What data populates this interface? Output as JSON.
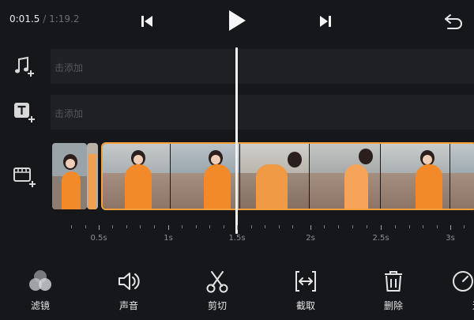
{
  "playback": {
    "current_time": "0:01.5",
    "separator": "/",
    "total_time": "1:19.2"
  },
  "tracks": {
    "music": {
      "icon": "music-note-add-icon",
      "hint": "击添加"
    },
    "text": {
      "icon": "text-add-icon",
      "hint": "击添加"
    },
    "video": {
      "icon": "video-add-icon"
    }
  },
  "ruler": {
    "labels": [
      "0.5s",
      "1s",
      "1.5s",
      "2s",
      "2.5s",
      "3s"
    ]
  },
  "toolbar": {
    "items": [
      {
        "label": "滤镜",
        "icon": "filter-icon"
      },
      {
        "label": "声音",
        "icon": "volume-icon"
      },
      {
        "label": "剪切",
        "icon": "scissors-icon"
      },
      {
        "label": "截取",
        "icon": "trim-icon"
      },
      {
        "label": "删除",
        "icon": "trash-icon"
      },
      {
        "label": "速",
        "icon": "speed-icon"
      }
    ]
  },
  "colors": {
    "background": "#16171b",
    "track": "#1f2024",
    "clip_border": "#f6a23c",
    "playhead": "#f2f2f2"
  }
}
